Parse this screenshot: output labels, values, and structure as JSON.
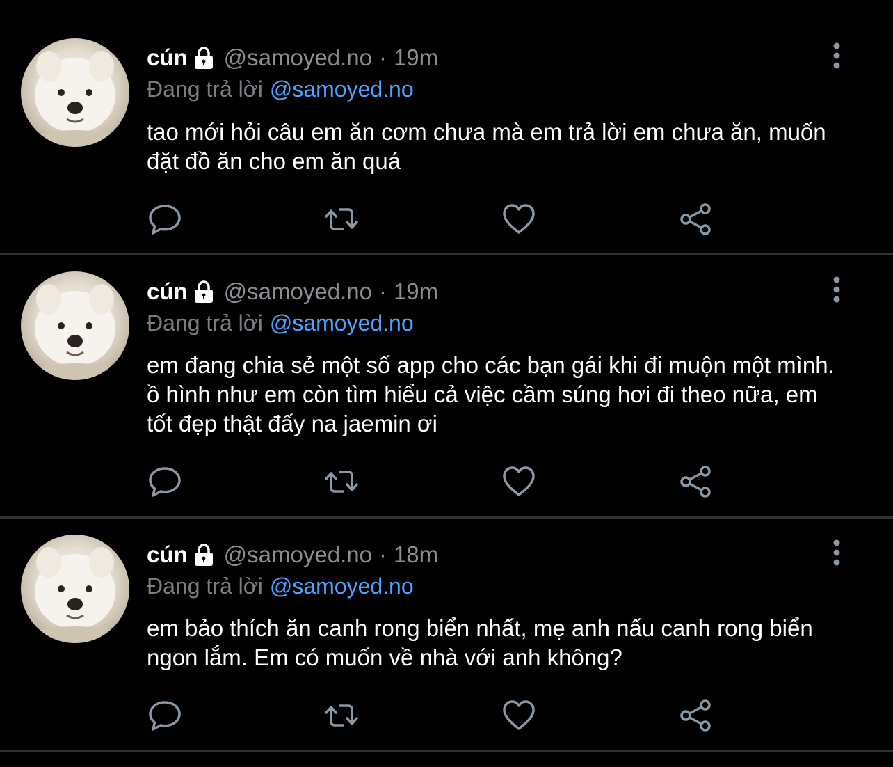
{
  "tweets": [
    {
      "name": "cún",
      "handle": "@samoyed.no",
      "separator": "·",
      "time": "19m",
      "reply_prefix": "Đang trả lời",
      "reply_to": "@samoyed.no",
      "text": "tao mới hỏi câu em ăn cơm chưa mà em trả lời em chưa ăn, muốn đặt đồ ăn cho em ăn quá"
    },
    {
      "name": "cún",
      "handle": "@samoyed.no",
      "separator": "·",
      "time": "19m",
      "reply_prefix": "Đang trả lời",
      "reply_to": "@samoyed.no",
      "text": "em đang chia sẻ một số app cho các bạn gái khi đi muộn một mình. ồ hình như em còn tìm hiểu cả việc cầm súng hơi đi theo nữa, em tốt đẹp thật đấy na jaemin ơi"
    },
    {
      "name": "cún",
      "handle": "@samoyed.no",
      "separator": "·",
      "time": "18m",
      "reply_prefix": "Đang trả lời",
      "reply_to": "@samoyed.no",
      "text": "em bảo thích ăn canh rong biển nhất, mẹ anh nấu canh rong biển ngon lắm. Em có muốn về nhà với anh không?"
    }
  ],
  "icons": {
    "lock": "lock-icon",
    "more": "more-vertical-icon",
    "reply": "reply-icon",
    "retweet": "retweet-icon",
    "like": "heart-icon",
    "share": "share-icon"
  },
  "colors": {
    "background": "#000000",
    "text": "#ffffff",
    "secondary": "#8b8f93",
    "link": "#4da3ff",
    "divider": "#2f3336",
    "icon": "#8b98a5"
  }
}
